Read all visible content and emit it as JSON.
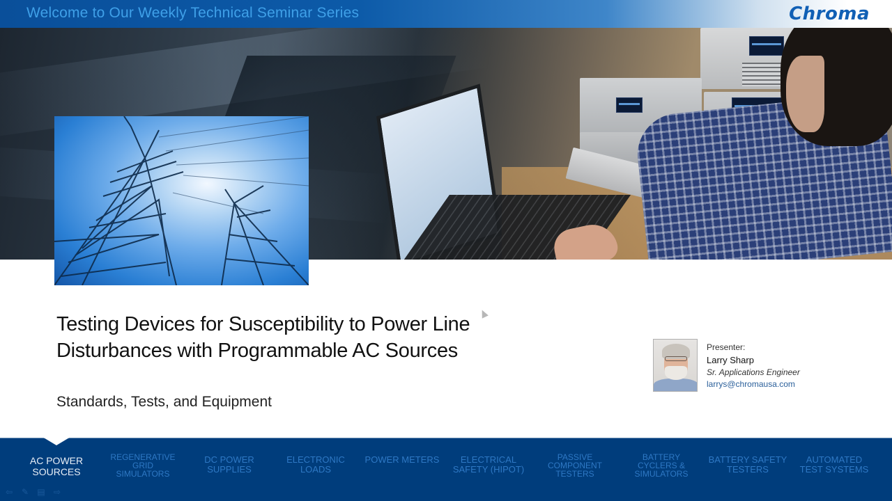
{
  "header": {
    "title": "Welcome to Our Weekly Technical Seminar Series",
    "logo_text": "Chroma",
    "brand_color": "#1160b5"
  },
  "banner": {
    "images": [
      "power-transmission-towers",
      "engineer-at-lab-bench-with-equipment"
    ]
  },
  "presentation": {
    "title_line1": "Testing Devices for Susceptibility to Power Line",
    "title_line2": "Disturbances with Programmable AC Sources",
    "subtitle": "Standards,  Tests, and Equipment"
  },
  "presenter": {
    "label": "Presenter:",
    "name": "Larry Sharp",
    "role": "Sr. Applications Engineer",
    "email": "larrys@chromausa.com"
  },
  "nav": {
    "background": "#003d7c",
    "active_index": 0,
    "items": [
      {
        "line1": "AC POWER",
        "line2": "SOURCES",
        "line3": ""
      },
      {
        "line1": "REGENERATIVE",
        "line2": "GRID",
        "line3": "SIMULATORS"
      },
      {
        "line1": "DC POWER",
        "line2": "SUPPLIES",
        "line3": ""
      },
      {
        "line1": "ELECTRONIC",
        "line2": "LOADS",
        "line3": ""
      },
      {
        "line1": "POWER METERS",
        "line2": "",
        "line3": ""
      },
      {
        "line1": "ELECTRICAL",
        "line2": "SAFETY (HIPOT)",
        "line3": ""
      },
      {
        "line1": "PASSIVE",
        "line2": "COMPONENT",
        "line3": "TESTERS"
      },
      {
        "line1": "BATTERY",
        "line2": "CYCLERS &",
        "line3": "SIMULATORS"
      },
      {
        "line1": "BATTERY SAFETY",
        "line2": "TESTERS",
        "line3": ""
      },
      {
        "line1": "AUTOMATED",
        "line2": "TEST SYSTEMS",
        "line3": ""
      }
    ]
  },
  "playback_controls": [
    {
      "icon": "previous-arrow-icon",
      "glyph": "⇦"
    },
    {
      "icon": "pen-icon",
      "glyph": "✎"
    },
    {
      "icon": "menu-icon",
      "glyph": "▤"
    },
    {
      "icon": "next-arrow-icon",
      "glyph": "⇨"
    }
  ]
}
